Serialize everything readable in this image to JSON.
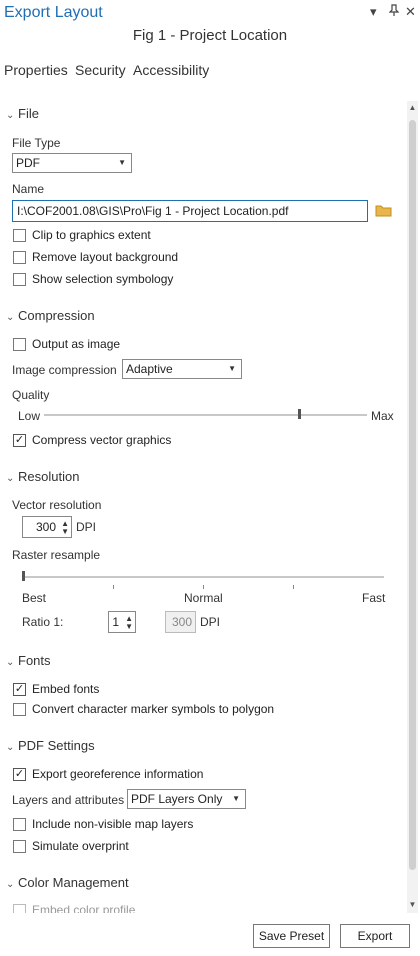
{
  "window": {
    "title": "Export Layout",
    "subtitle": "Fig 1 - Project Location",
    "pin_glyph": "▾",
    "dock_glyph": "↕",
    "close_glyph": "✕"
  },
  "tabs": [
    "Properties",
    "Security",
    "Accessibility"
  ],
  "file": {
    "header": "File",
    "file_type_label": "File Type",
    "file_type_value": "PDF",
    "name_label": "Name",
    "name_value": "I:\\COF2001.08\\GIS\\Pro\\Fig 1 - Project Location.pdf",
    "clip_label": "Clip to graphics extent",
    "remove_bg_label": "Remove layout background",
    "show_sel_label": "Show selection symbology"
  },
  "compression": {
    "header": "Compression",
    "output_image_label": "Output as image",
    "image_compression_label": "Image compression",
    "image_compression_value": "Adaptive",
    "quality_label": "Quality",
    "low_label": "Low",
    "max_label": "Max",
    "quality_level": 0.79,
    "compress_vector_label": "Compress vector graphics"
  },
  "resolution": {
    "header": "Resolution",
    "vector_label": "Vector resolution",
    "vector_value": "300",
    "dpi_label": "DPI",
    "raster_label": "Raster resample",
    "best_label": "Best",
    "normal_label": "Normal",
    "fast_label": "Fast",
    "ratio_label": "Ratio 1:",
    "ratio_value": "1",
    "ratio_dpi_value": "300",
    "ratio_dpi_label": "DPI"
  },
  "fonts": {
    "header": "Fonts",
    "embed_label": "Embed fonts",
    "convert_label": "Convert character marker symbols to polygon"
  },
  "pdf": {
    "header": "PDF Settings",
    "georef_label": "Export georeference information",
    "layers_label": "Layers and attributes",
    "layers_value": "PDF Layers Only",
    "nonvisible_label": "Include non-visible map layers",
    "overprint_label": "Simulate overprint"
  },
  "color": {
    "header": "Color Management",
    "embed_profile_label": "Embed color profile"
  },
  "buttons": {
    "save_preset": "Save Preset",
    "export": "Export"
  },
  "icons": {
    "chevron": "⌄",
    "check": "✓",
    "caret": "▼",
    "up": "▲",
    "down": "▼"
  },
  "colors": {
    "accent": "#1f6fb5",
    "folder": "#e8b64a"
  }
}
